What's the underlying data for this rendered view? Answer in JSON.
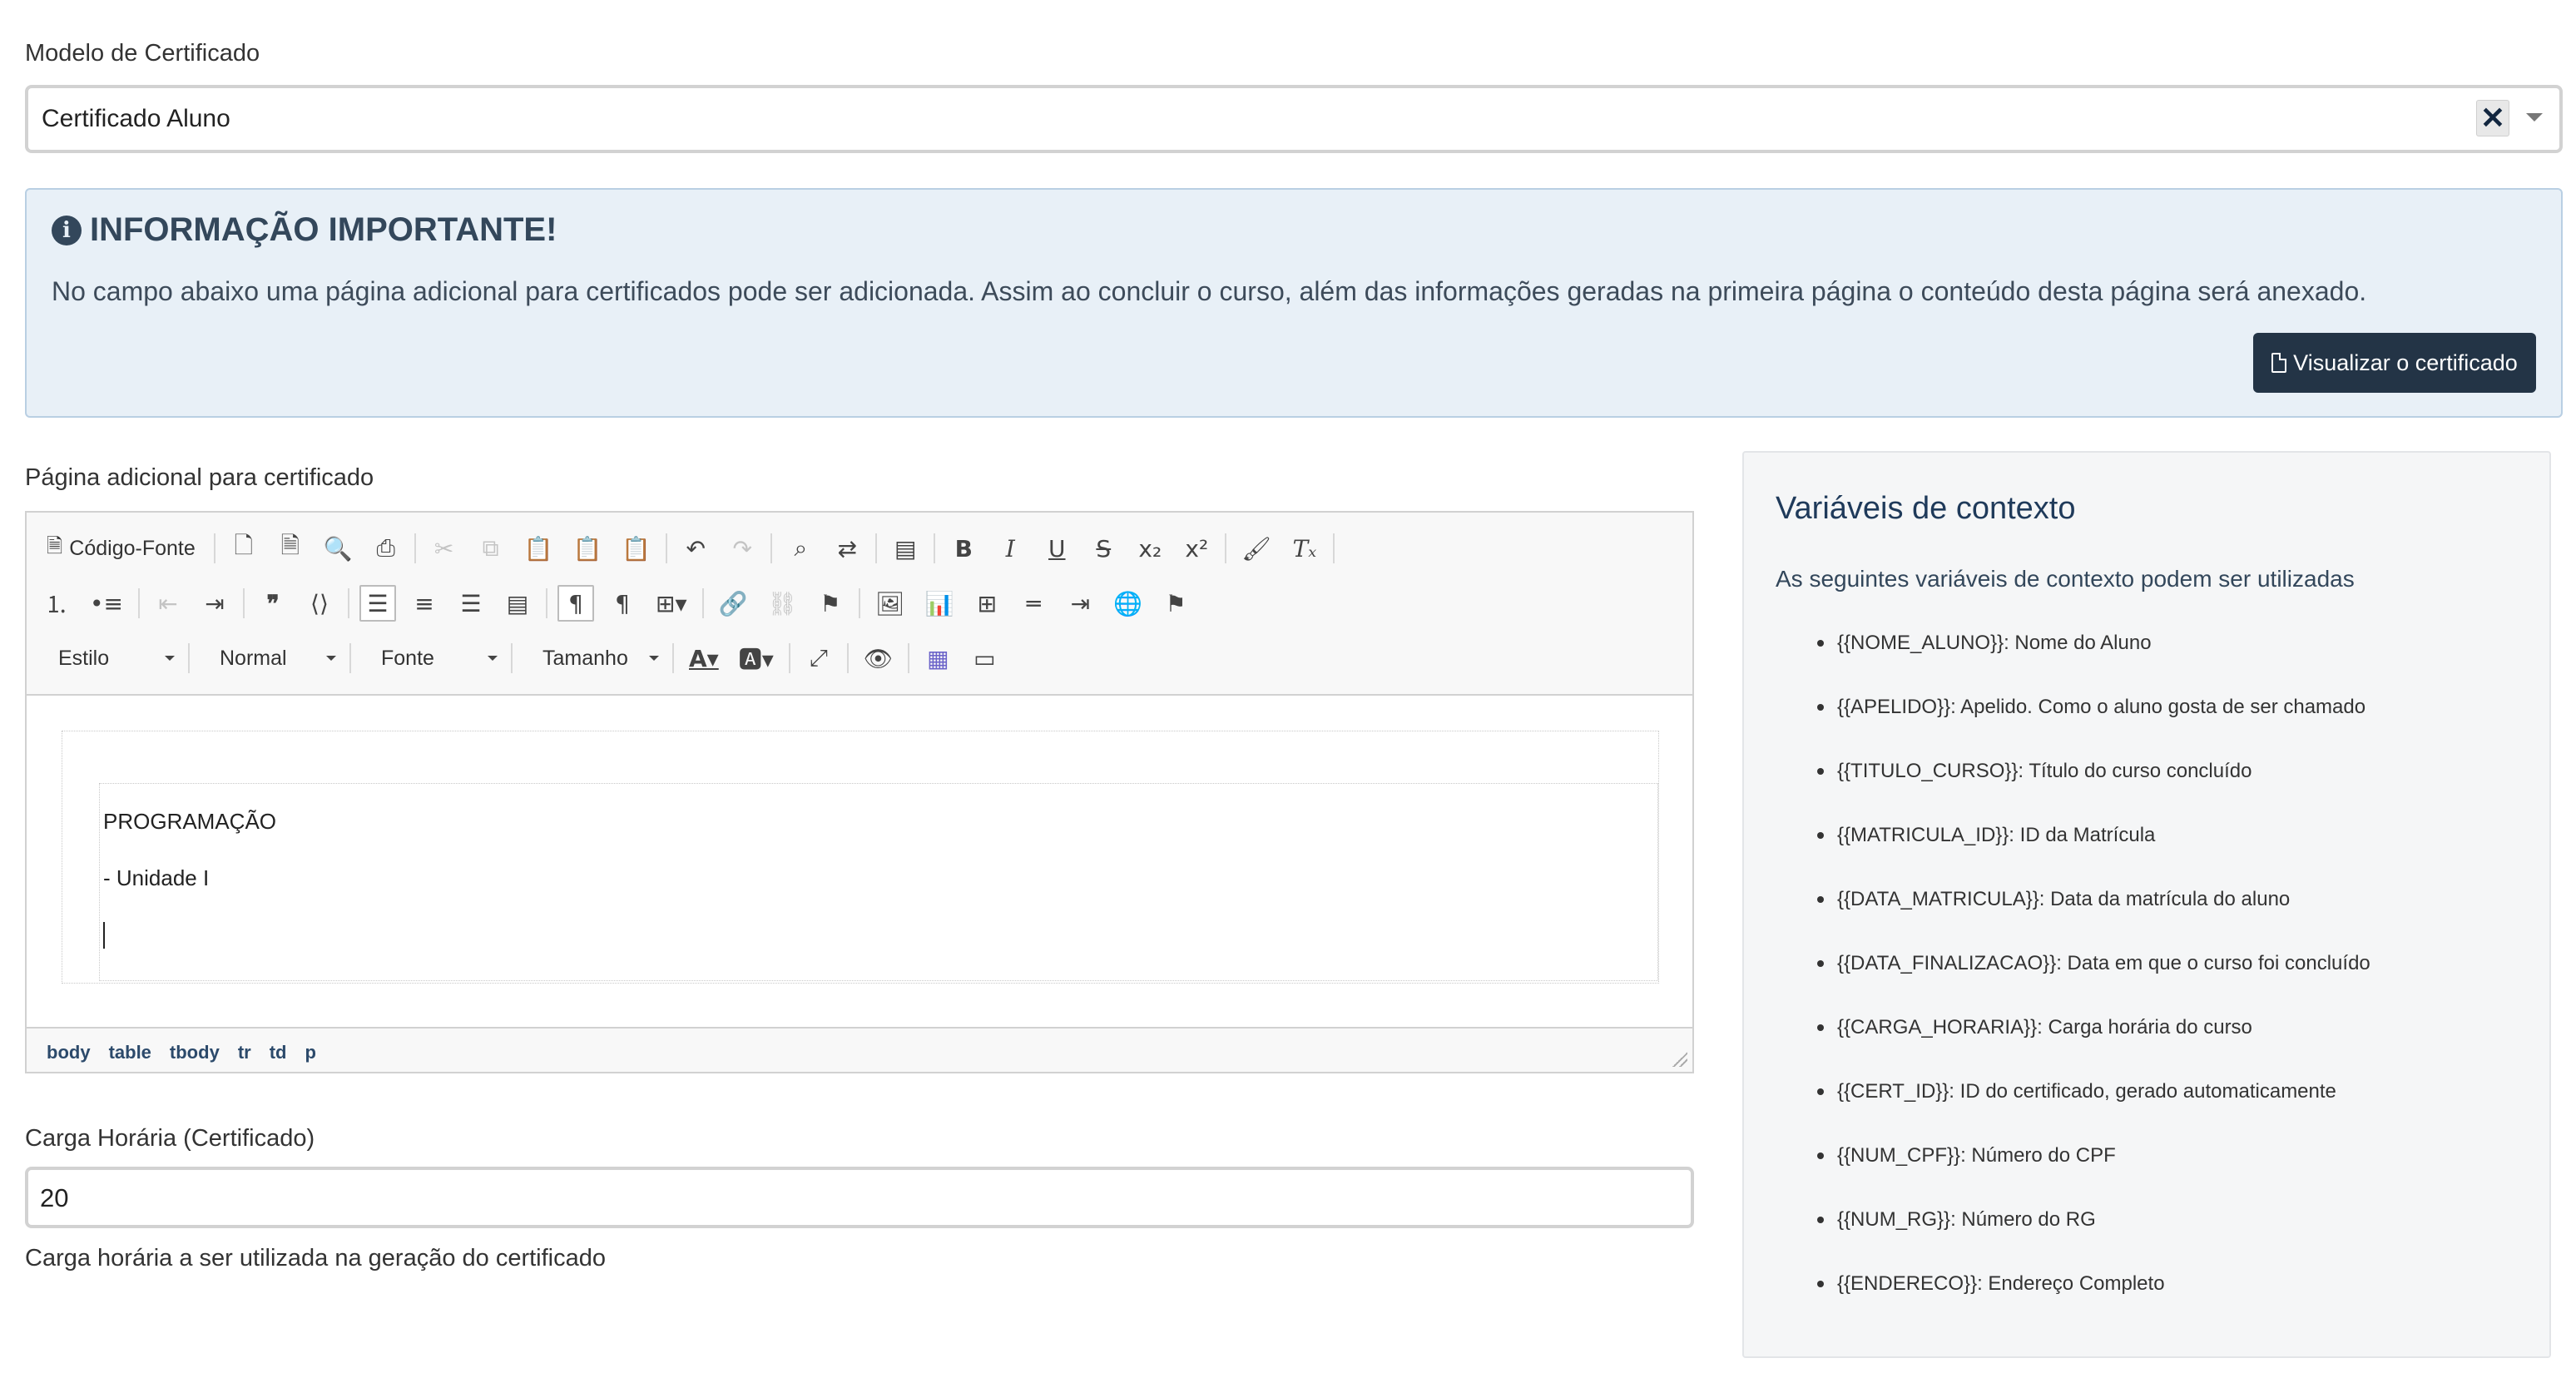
{
  "certificate_model": {
    "label": "Modelo de Certificado",
    "value": "Certificado Aluno"
  },
  "info": {
    "title": "INFORMAÇÃO IMPORTANTE!",
    "text": "No campo abaixo uma página adicional para certificados pode ser adicionada. Assim ao concluir o curso, além das informações geradas na primeira página o conteúdo desta página será anexado.",
    "button_label": "Visualizar o certificado"
  },
  "editor": {
    "label": "Página adicional para certificado",
    "source_label": "Código-Fonte",
    "style_combo": "Estilo",
    "format_combo": "Normal",
    "font_combo": "Fonte",
    "size_combo": "Tamanho",
    "content": {
      "line1": "PROGRAMAÇÃO",
      "line2": "- Unidade I"
    },
    "path": [
      "body",
      "table",
      "tbody",
      "tr",
      "td",
      "p"
    ]
  },
  "hours": {
    "label": "Carga Horária (Certificado)",
    "value": "20",
    "help": "Carga horária a ser utilizada na geração do certificado"
  },
  "context": {
    "title": "Variáveis de contexto",
    "intro": "As seguintes variáveis de contexto podem ser utilizadas",
    "items": [
      "{{NOME_ALUNO}}: Nome do Aluno",
      "{{APELIDO}}: Apelido. Como o aluno gosta de ser chamado",
      "{{TITULO_CURSO}}: Título do curso concluído",
      "{{MATRICULA_ID}}: ID da Matrícula",
      "{{DATA_MATRICULA}}: Data da matrícula do aluno",
      "{{DATA_FINALIZACAO}}: Data em que o curso foi concluído",
      "{{CARGA_HORARIA}}: Carga horária do curso",
      "{{CERT_ID}}: ID do certificado, gerado automaticamente",
      "{{NUM_CPF}}: Número do CPF",
      "{{NUM_RG}}: Número do RG",
      "{{ENDERECO}}: Endereço Completo"
    ]
  }
}
